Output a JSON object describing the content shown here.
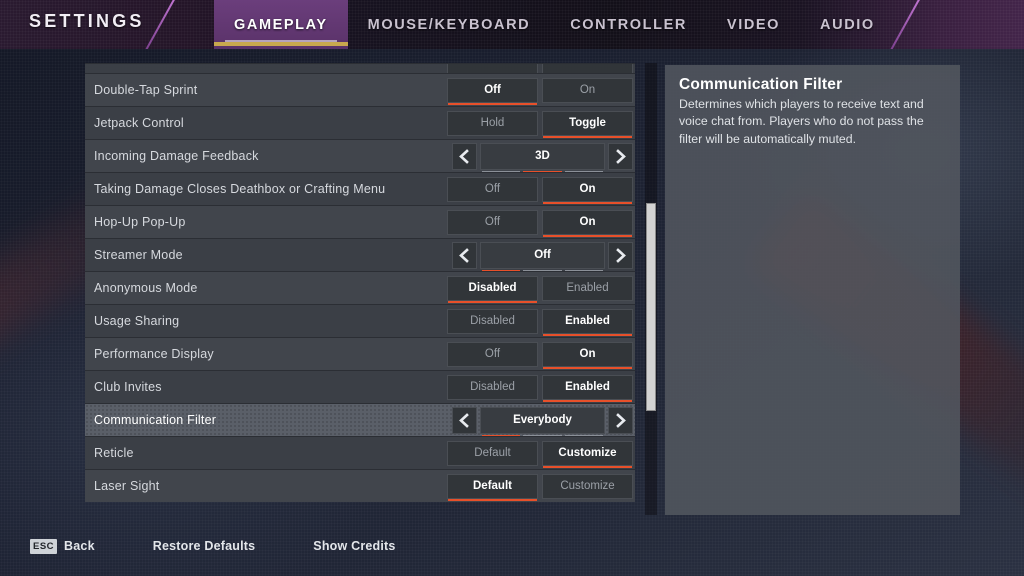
{
  "header": {
    "title": "SETTINGS",
    "tabs": [
      {
        "label": "GAMEPLAY",
        "active": true
      },
      {
        "label": "MOUSE/KEYBOARD",
        "active": false
      },
      {
        "label": "CONTROLLER",
        "active": false
      },
      {
        "label": "VIDEO",
        "active": false
      },
      {
        "label": "AUDIO",
        "active": false
      }
    ],
    "accent_active_tab_bg": "#6b3e7c",
    "accent_active_tab_underline": "#c8a84e"
  },
  "settings": {
    "accent_selected": "#e8502a",
    "rows": [
      {
        "label": "",
        "type": "partial",
        "control": "toggle",
        "options": [
          "",
          ""
        ],
        "selected_index": 1
      },
      {
        "label": "Double-Tap Sprint",
        "type": "toggle",
        "options": [
          "Off",
          "On"
        ],
        "selected_index": 0
      },
      {
        "label": "Jetpack Control",
        "type": "toggle",
        "options": [
          "Hold",
          "Toggle"
        ],
        "selected_index": 1
      },
      {
        "label": "Incoming Damage Feedback",
        "type": "stepper",
        "value": "3D",
        "segments": 3,
        "segment_active": 1
      },
      {
        "label": "Taking Damage Closes Deathbox or Crafting Menu",
        "type": "toggle",
        "options": [
          "Off",
          "On"
        ],
        "selected_index": 1
      },
      {
        "label": "Hop-Up Pop-Up",
        "type": "toggle",
        "options": [
          "Off",
          "On"
        ],
        "selected_index": 1
      },
      {
        "label": "Streamer Mode",
        "type": "stepper",
        "value": "Off",
        "segments": 3,
        "segment_active": 0
      },
      {
        "label": "Anonymous Mode",
        "type": "toggle",
        "options": [
          "Disabled",
          "Enabled"
        ],
        "selected_index": 0
      },
      {
        "label": "Usage Sharing",
        "type": "toggle",
        "options": [
          "Disabled",
          "Enabled"
        ],
        "selected_index": 1
      },
      {
        "label": "Performance Display",
        "type": "toggle",
        "options": [
          "Off",
          "On"
        ],
        "selected_index": 1
      },
      {
        "label": "Club Invites",
        "type": "toggle",
        "options": [
          "Disabled",
          "Enabled"
        ],
        "selected_index": 1
      },
      {
        "label": "Communication Filter",
        "type": "stepper",
        "value": "Everybody",
        "segments": 3,
        "segment_active": 0,
        "selected": true
      },
      {
        "label": "Reticle",
        "type": "toggle",
        "options": [
          "Default",
          "Customize"
        ],
        "selected_index": 1
      },
      {
        "label": "Laser Sight",
        "type": "toggle",
        "options": [
          "Default",
          "Customize"
        ],
        "selected_index": 0
      }
    ]
  },
  "scrollbar": {
    "thumb_top_pct": 31,
    "thumb_height_pct": 46
  },
  "info_panel": {
    "title": "Communication Filter",
    "body": "Determines which players to receive text and voice chat from. Players who do not pass the filter will be automatically muted."
  },
  "footer": {
    "items": [
      {
        "key": "ESC",
        "label": "Back"
      },
      {
        "key": "",
        "label": "Restore Defaults"
      },
      {
        "key": "",
        "label": "Show Credits"
      }
    ]
  }
}
